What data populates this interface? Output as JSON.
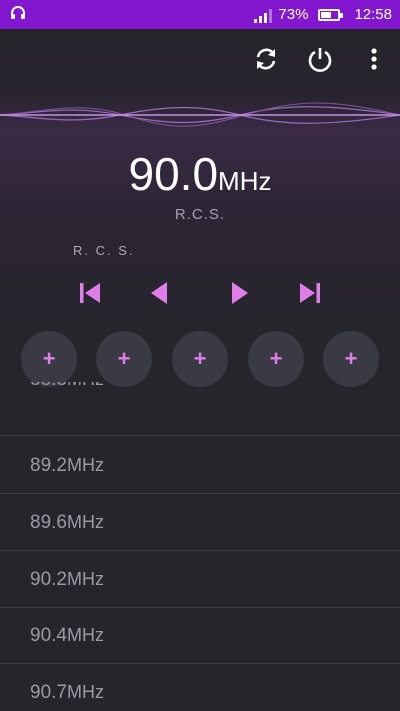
{
  "status_bar": {
    "battery_percent": "73%",
    "time": "12:58",
    "signal_bars": 3
  },
  "toolbar": {
    "refresh_icon": "refresh-icon",
    "power_icon": "power-icon",
    "menu_icon": "overflow-menu-icon"
  },
  "tuner": {
    "frequency": "90.0",
    "unit": "MHz",
    "station_name": "R.C.S.",
    "rds_text": "R. C. S."
  },
  "controls": [
    "skip-previous-icon",
    "seek-back-icon",
    "play-icon",
    "skip-next-icon"
  ],
  "presets": [
    {
      "label": "+"
    },
    {
      "label": "+"
    },
    {
      "label": "+"
    },
    {
      "label": "+"
    },
    {
      "label": "+"
    }
  ],
  "stations": [
    {
      "freq": "88.8",
      "unit": "MHz"
    },
    {
      "freq": "89.2",
      "unit": "MHz"
    },
    {
      "freq": "89.6",
      "unit": "MHz"
    },
    {
      "freq": "90.2",
      "unit": "MHz"
    },
    {
      "freq": "90.4",
      "unit": "MHz"
    },
    {
      "freq": "90.7",
      "unit": "MHz"
    }
  ],
  "colors": {
    "status_bar": "#8317cf",
    "accent": "#e07ee9",
    "background": "#25252b"
  }
}
